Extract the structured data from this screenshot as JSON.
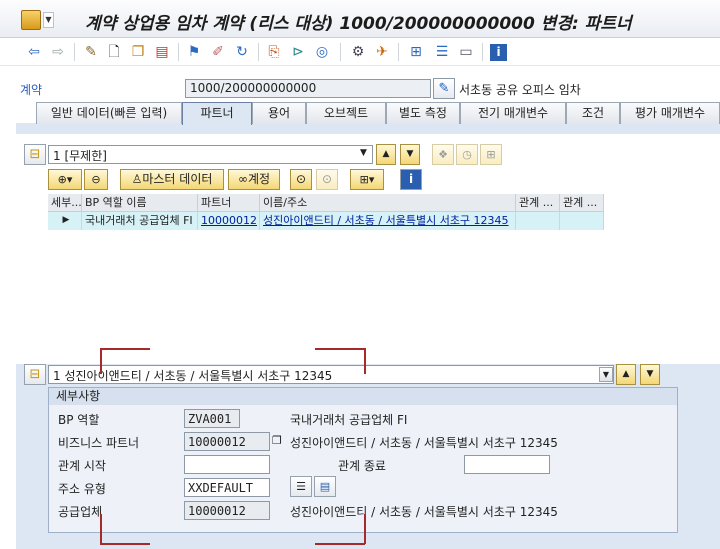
{
  "window": {
    "title": "계약 상업용 임차 계약 (리스 대상) 1000/200000000000 변경: 파트너"
  },
  "header": {
    "contract_label": "계약",
    "contract_value": "1000/200000000000",
    "contract_desc": "서초동 공유 오피스 임차"
  },
  "tabs": [
    {
      "label": "일반 데이터(빠른 입력)"
    },
    {
      "label": "파트너",
      "active": true
    },
    {
      "label": "용어"
    },
    {
      "label": "오브젝트"
    },
    {
      "label": "별도 측정"
    },
    {
      "label": "전기 매개변수"
    },
    {
      "label": "조건"
    },
    {
      "label": "평가 매개변수"
    }
  ],
  "partner_view": {
    "selected": "1 [무제한]"
  },
  "grid_toolbar": {
    "master_data_label": "마스터 데이터",
    "account_label": "계정"
  },
  "grid": {
    "columns": [
      "세부...",
      "BP 역할 이름",
      "파트너",
      "이름/주소",
      "관계 ...",
      "관계 ..."
    ],
    "rows": [
      {
        "role": "국내거래처 공급업체 FI",
        "partner": "10000012",
        "name": "성진아이앤드티 / 서초동 / 서울특별시 서초구 12345"
      }
    ]
  },
  "partner_select": {
    "value": "1 성진아이앤드티 / 서초동 / 서울특별시 서초구 12345"
  },
  "details": {
    "title": "세부사항",
    "bp_role_label": "BP 역할",
    "bp_role_value": "ZVA001",
    "bp_role_desc": "국내거래처 공급업체 FI",
    "bp_label": "비즈니스 파트너",
    "bp_value": "10000012",
    "bp_desc": "성진아이앤드티 / 서초동 / 서울특별시 서초구 12345",
    "rel_start_label": "관계 시작",
    "rel_start_value": "",
    "rel_end_label": "관계 종료",
    "rel_end_value": "",
    "addr_type_label": "주소 유형",
    "addr_type_value": "XXDEFAULT",
    "vendor_label": "공급업체",
    "vendor_value": "10000012",
    "vendor_desc": "성진아이앤드티 / 서초동 / 서울특별시 서초구 12345"
  },
  "colors": {
    "link": "#00209f",
    "selected_row": "#d6f2f6",
    "panel_bg": "#dde6f3",
    "annotation": "#a52a2a"
  }
}
